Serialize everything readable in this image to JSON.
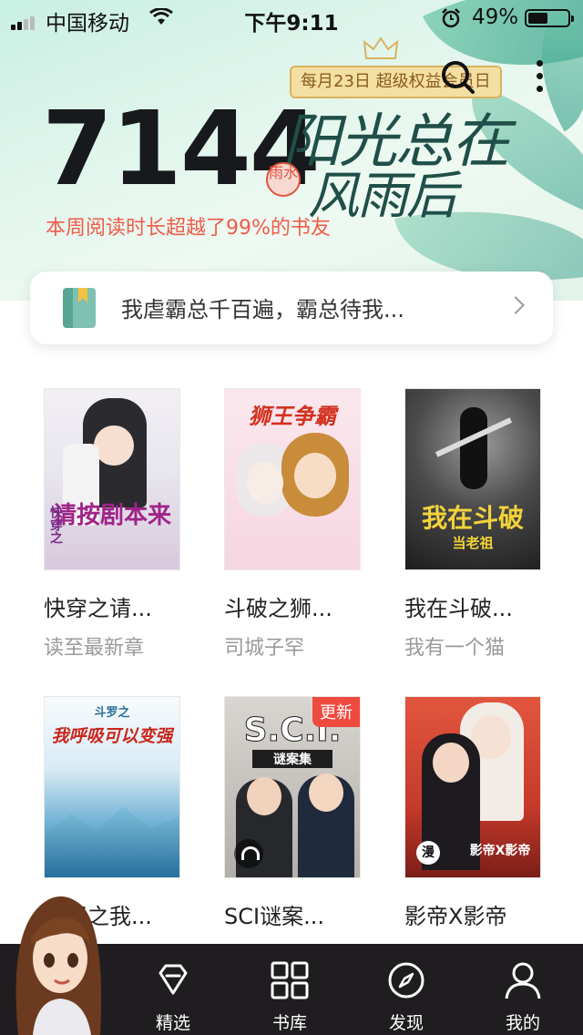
{
  "status_bar": {
    "carrier": "中国移动",
    "time": "下午9:11",
    "battery": "49%",
    "battery_level": 0.49
  },
  "banner": {
    "reading_minutes": "7144",
    "description": "本周阅读时长超越了99%的书友",
    "slogan_line1": "阳光总在",
    "slogan_line2": "风雨后",
    "seal_text": "雨水",
    "promo": "每月23日 超级权益会员日",
    "colors": {
      "accent": "#ef5c4a",
      "promo_bg": "#f4dfa3"
    }
  },
  "reading_card": {
    "title": "我虐霸总千百遍，霸总待我..."
  },
  "books": [
    {
      "cover_text": "请按剧本来",
      "cover_small": "快穿之",
      "name": "快穿之请...",
      "sub": "读至最新章"
    },
    {
      "cover_text": "狮王争霸",
      "name": "斗破之狮...",
      "sub": "司城子罕"
    },
    {
      "cover_text": "我在斗破",
      "cover_small": "当老祖",
      "name": "我在斗破...",
      "sub": "我有一个猫"
    },
    {
      "cover_text": "我呼吸可以变强",
      "cover_small": "斗罗之",
      "name": "斗罗之我...",
      "sub": ""
    },
    {
      "cover_text": "S.C.I.",
      "cover_small": "谜案集",
      "badge": "更新",
      "name": "SCI谜案...",
      "sub": ""
    },
    {
      "cover_text": "影帝X影帝",
      "comic_mark": "漫",
      "name": "影帝X影帝",
      "sub": ""
    }
  ],
  "tabbar": {
    "tabs": [
      {
        "label": "精选",
        "icon": "diamond-icon"
      },
      {
        "label": "书库",
        "icon": "grid-icon"
      },
      {
        "label": "发现",
        "icon": "compass-icon"
      },
      {
        "label": "我的",
        "icon": "person-icon"
      }
    ]
  }
}
